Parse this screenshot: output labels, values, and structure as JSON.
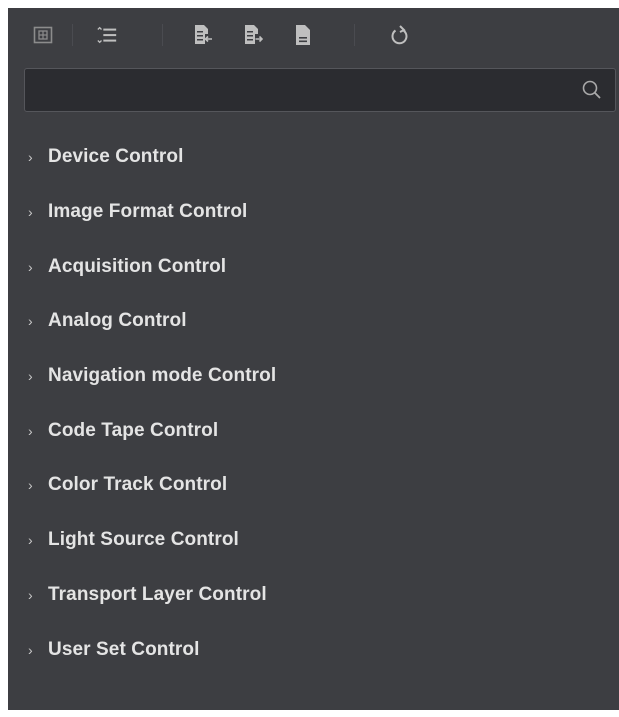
{
  "toolbar": {
    "buttons": [
      {
        "icon": "grid-view-icon"
      },
      {
        "icon": "list-view-icon"
      },
      {
        "icon": "import-file-icon"
      },
      {
        "icon": "export-file-icon"
      },
      {
        "icon": "document-icon"
      },
      {
        "icon": "refresh-icon"
      }
    ]
  },
  "search": {
    "value": "",
    "placeholder": ""
  },
  "tree": {
    "items": [
      {
        "label": "Device Control"
      },
      {
        "label": "Image Format Control"
      },
      {
        "label": "Acquisition Control"
      },
      {
        "label": "Analog Control"
      },
      {
        "label": "Navigation mode Control"
      },
      {
        "label": "Code Tape Control"
      },
      {
        "label": "Color Track Control"
      },
      {
        "label": "Light Source Control"
      },
      {
        "label": "Transport Layer Control"
      },
      {
        "label": "User Set Control"
      }
    ]
  },
  "colors": {
    "panel_bg": "#3d3e42",
    "search_bg": "#2b2c30",
    "text": "#e4e4e4",
    "icon": "#bfbfbf"
  }
}
